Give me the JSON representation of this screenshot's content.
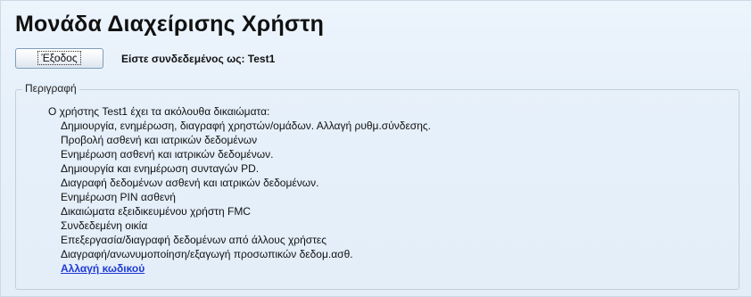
{
  "page": {
    "title": "Μονάδα Διαχείρισης Χρήστη"
  },
  "toolbar": {
    "exit_button": "Έξοδος",
    "logged_in_text": "Είστε συνδεδεμένος ως: Test1"
  },
  "description": {
    "legend": "Περιγραφή",
    "intro": "Ο χρήστης Test1 έχει τα ακόλουθα δικαιώματα:",
    "permissions": [
      "Δημιουργία, ενημέρωση, διαγραφή χρηστών/ομάδων. Αλλαγή ρυθμ.σύνδεσης.",
      "Προβολή ασθενή και ιατρικών δεδομένων",
      "Ενημέρωση ασθενή και ιατρικών δεδομένων.",
      "Δημιουργία και ενημέρωση συνταγών PD.",
      "Διαγραφή δεδομένων ασθενή και ιατρικών δεδομένων.",
      "Ενημέρωση PIN ασθενή",
      "Δικαιώματα εξειδικευμένου χρήστη FMC",
      "Συνδεδεμένη οικία",
      "Επεξεργασία/διαγραφή δεδομένων από άλλους χρήστες",
      "Διαγραφή/ανωνυμοποίηση/εξαγωγή προσωπικών δεδομ.ασθ."
    ],
    "change_password_link": "Αλλαγή κωδικού"
  }
}
